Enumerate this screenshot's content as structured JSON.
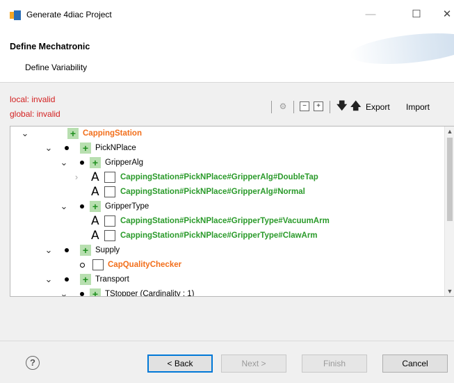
{
  "window": {
    "title": "Generate 4diac Project",
    "min": "—",
    "max": "☐",
    "close": "✕"
  },
  "header": {
    "title": "Define Mechatronic",
    "subtitle": "Define Variability"
  },
  "status": {
    "local": "local: invalid",
    "global": "global: invalid"
  },
  "toolbar": {
    "export": "Export",
    "import": "Import"
  },
  "tree": {
    "root": "CappingStation",
    "pick_n_place": "PickNPlace",
    "gripper_alg": "GripperAlg",
    "double_tap": "CappingStation#PickNPlace#GripperAlg#DoubleTap",
    "normal": "CappingStation#PickNPlace#GripperAlg#Normal",
    "gripper_type": "GripperType",
    "vacuum_arm": "CappingStation#PickNPlace#GripperType#VacuumArm",
    "claw_arm": "CappingStation#PickNPlace#GripperType#ClawArm",
    "supply": "Supply",
    "cap_quality_checker": "CapQualityChecker",
    "transport": "Transport",
    "tstopper": "TStopper (Cardinality : 1)"
  },
  "buttons": {
    "back": "< Back",
    "next": "Next >",
    "finish": "Finish",
    "cancel": "Cancel",
    "help": "?"
  }
}
